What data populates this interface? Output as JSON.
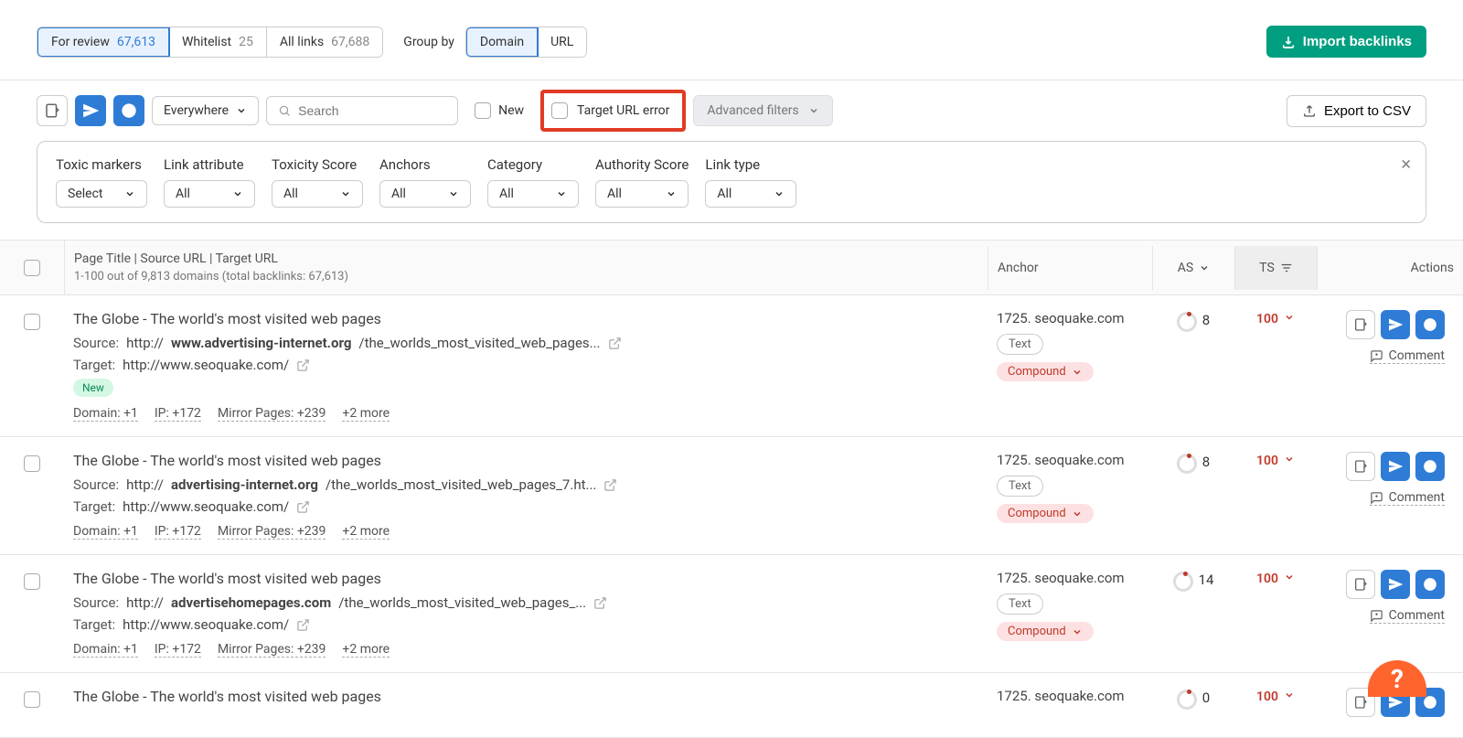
{
  "tabs": {
    "for_review": {
      "label": "For review",
      "count": "67,613"
    },
    "whitelist": {
      "label": "Whitelist",
      "count": "25"
    },
    "all_links": {
      "label": "All links",
      "count": "67,688"
    }
  },
  "group_by": {
    "label": "Group by",
    "domain": "Domain",
    "url": "URL"
  },
  "import_btn": "Import backlinks",
  "toolbar": {
    "everywhere": "Everywhere",
    "search_placeholder": "Search",
    "new_label": "New",
    "target_url_error": "Target URL error",
    "advanced_filters": "Advanced filters",
    "export_csv": "Export to CSV"
  },
  "filters": {
    "toxic_markers": {
      "label": "Toxic markers",
      "value": "Select"
    },
    "link_attribute": {
      "label": "Link attribute",
      "value": "All"
    },
    "toxicity_score": {
      "label": "Toxicity Score",
      "value": "All"
    },
    "anchors": {
      "label": "Anchors",
      "value": "All"
    },
    "category": {
      "label": "Category",
      "value": "All"
    },
    "authority_score": {
      "label": "Authority Score",
      "value": "All"
    },
    "link_type": {
      "label": "Link type",
      "value": "All"
    }
  },
  "table": {
    "head_main": "Page Title | Source URL | Target URL",
    "head_sub": "1-100 out of 9,813 domains (total backlinks: 67,613)",
    "anchor": "Anchor",
    "as": "AS",
    "ts": "TS",
    "actions": "Actions"
  },
  "rows": [
    {
      "title": "The Globe - The world's most visited web pages",
      "source_pre": "http://",
      "source_bold": "www.advertising-internet.org",
      "source_rest": "/the_worlds_most_visited_web_pages...",
      "target": "http://www.seoquake.com/",
      "new": "New",
      "meta": {
        "domain": "Domain: +1",
        "ip": "IP: +172",
        "mirror": "Mirror Pages: +239",
        "more": "+2 more"
      },
      "anchor": "1725. seoquake.com",
      "anchor_type": "Text",
      "anchor_compound": "Compound",
      "as": "8",
      "ts": "100"
    },
    {
      "title": "The Globe - The world's most visited web pages",
      "source_pre": "http://",
      "source_bold": "advertising-internet.org",
      "source_rest": "/the_worlds_most_visited_web_pages_7.ht...",
      "target": "http://www.seoquake.com/",
      "new": null,
      "meta": {
        "domain": "Domain: +1",
        "ip": "IP: +172",
        "mirror": "Mirror Pages: +239",
        "more": "+2 more"
      },
      "anchor": "1725. seoquake.com",
      "anchor_type": "Text",
      "anchor_compound": "Compound",
      "as": "8",
      "ts": "100"
    },
    {
      "title": "The Globe - The world's most visited web pages",
      "source_pre": "http://",
      "source_bold": "advertisehomepages.com",
      "source_rest": "/the_worlds_most_visited_web_pages_...",
      "target": "http://www.seoquake.com/",
      "new": null,
      "meta": {
        "domain": "Domain: +1",
        "ip": "IP: +172",
        "mirror": "Mirror Pages: +239",
        "more": "+2 more"
      },
      "anchor": "1725. seoquake.com",
      "anchor_type": "Text",
      "anchor_compound": "Compound",
      "as": "14",
      "ts": "100"
    },
    {
      "title": "The Globe - The world's most visited web pages",
      "anchor": "1725. seoquake.com",
      "as": "0",
      "ts": "100"
    }
  ],
  "comment": "Comment"
}
